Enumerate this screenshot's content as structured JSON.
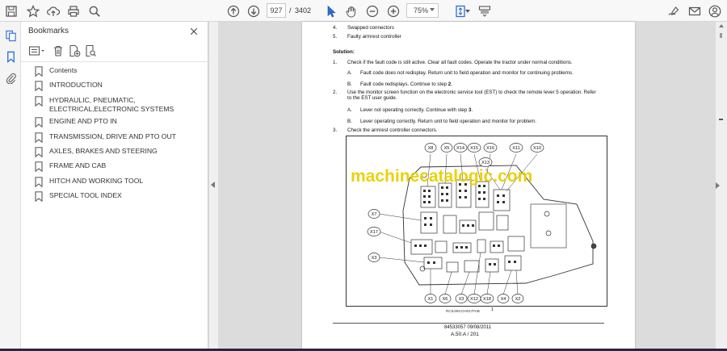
{
  "toolbar": {
    "page_current": "927",
    "page_separator": "/",
    "page_total": "3402",
    "zoom": "75%"
  },
  "panel": {
    "title": "Bookmarks",
    "items": [
      {
        "label": "Contents"
      },
      {
        "label": "INTRODUCTION"
      },
      {
        "label": "HYDRAULIC, PNEUMATIC, ELECTRICAL,ELECTRONIC SYSTEMS"
      },
      {
        "label": "ENGINE AND PTO IN"
      },
      {
        "label": "TRANSMISSION, DRIVE AND PTO OUT"
      },
      {
        "label": "AXLES, BRAKES AND STEERING"
      },
      {
        "label": "FRAME AND CAB"
      },
      {
        "label": "HITCH AND WORKING TOOL"
      },
      {
        "label": "SPECIAL TOOL INDEX"
      }
    ]
  },
  "doc": {
    "cause4_num": "4.",
    "cause4_text": "Swapped connectors",
    "cause5_num": "5.",
    "cause5_text": "Faulty armrest controller",
    "solution_heading": "Solution:",
    "s1_num": "1.",
    "s1_text": "Check if the fault code is still active. Clear all fault codes. Operate the tractor under normal conditions.",
    "s1a_letter": "A.",
    "s1a_text": "Fault code does not redisplay. Return unit to field operation and monitor for continuing problems.",
    "s1b_letter": "B.",
    "s1b_text_pre": "Fault code redisplays.  Continue to step ",
    "s1b_step": "2",
    "s1b_text_post": ".",
    "s2_num": "2.",
    "s2_text_line1": "Use the monitor screen function on the electronic service tool (EST) to check the remote lever 5 operation.  Refer",
    "s2_text_line2": "to the EST user guide.",
    "s2a_letter": "A.",
    "s2a_text_pre": "Lever not operating correctly.  Continue with step ",
    "s2a_step": "3",
    "s2a_text_post": ".",
    "s2b_letter": "B.",
    "s2b_text": "Lever operating correctly.  Return unit to field operation and monitor for problem.",
    "s3_num": "3.",
    "s3_text": "Check the armrest controller connectors.",
    "fig_ref": "RCIL09CCH017FAB",
    "fig_num": "1",
    "footer_docno": "84533057 09/08/2011",
    "footer_page": "A.50.A / 201",
    "watermark": "machinecatalogic.com"
  },
  "diagram": {
    "connectors_top": [
      "X8",
      "X5",
      "X14",
      "X15",
      "X16",
      "X11",
      "X10"
    ],
    "connector_x13": "X13",
    "connectors_left": [
      "X7",
      "X17",
      "X3"
    ],
    "connectors_bottom": [
      "X1",
      "X6",
      "X3",
      "X12",
      "X18",
      "X4",
      "X2"
    ]
  }
}
